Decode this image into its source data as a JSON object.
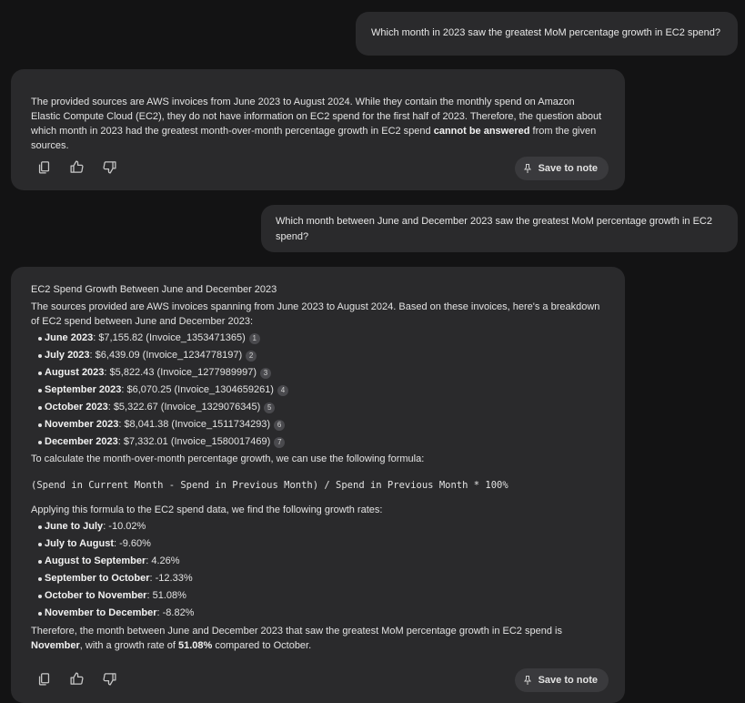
{
  "conversation": {
    "q1": "Which month in 2023 saw the greatest MoM percentage growth in EC2 spend?",
    "a1": {
      "pre": "The provided sources are AWS invoices from June 2023 to August 2024. While they contain the monthly spend on Amazon Elastic Compute Cloud (EC2), they do not have information on EC2 spend for the first half of 2023. Therefore, the question about which month in 2023 had the greatest month-over-month percentage growth in EC2 spend ",
      "bold": "cannot be answered",
      "post": " from the given sources."
    },
    "q2": "Which month between June and December 2023 saw the greatest MoM percentage growth in EC2 spend?",
    "a2": {
      "title": "EC2 Spend Growth Between June and December 2023",
      "intro": "The sources provided are AWS invoices spanning from June 2023 to August 2024. Based on these invoices, here's a breakdown of EC2 spend between June and December 2023:",
      "spend": [
        {
          "month": "June 2023",
          "rest": ": $7,155.82 (Invoice_1353471365)",
          "cite": "1"
        },
        {
          "month": "July 2023",
          "rest": ": $6,439.09 (Invoice_1234778197)",
          "cite": "2"
        },
        {
          "month": "August 2023",
          "rest": ": $5,822.43 (Invoice_1277989997)",
          "cite": "3"
        },
        {
          "month": "September 2023",
          "rest": ": $6,070.25 (Invoice_1304659261)",
          "cite": "4"
        },
        {
          "month": "October 2023",
          "rest": ": $5,322.67 (Invoice_1329076345)",
          "cite": "5"
        },
        {
          "month": "November 2023",
          "rest": ": $8,041.38 (Invoice_1511734293)",
          "cite": "6"
        },
        {
          "month": "December 2023",
          "rest": ": $7,332.01 (Invoice_1580017469)",
          "cite": "7"
        }
      ],
      "calc_intro": "To calculate the month-over-month percentage growth, we can use the following formula:",
      "formula": "(Spend in Current Month - Spend in Previous Month) / Spend in Previous Month * 100%",
      "apply": "Applying this formula to the EC2 spend data, we find the following growth rates:",
      "growth": [
        {
          "label": "June to July",
          "value": ": -10.02%"
        },
        {
          "label": "July to August",
          "value": ": -9.60%"
        },
        {
          "label": "August to September",
          "value": ": 4.26%"
        },
        {
          "label": "September to October",
          "value": ": -12.33%"
        },
        {
          "label": "October to November",
          "value": ": 51.08%"
        },
        {
          "label": "November to December",
          "value": ": -8.82%"
        }
      ],
      "concl_pre": "Therefore, the month between June and December 2023 that saw the greatest MoM percentage growth in EC2 spend is ",
      "concl_month": "November",
      "concl_mid": ", with a growth rate of ",
      "concl_rate": "51.08%",
      "concl_post": " compared to October."
    }
  },
  "actions": {
    "save_label": "Save to note",
    "icons": [
      "copy-icon",
      "thumbs-up-icon",
      "thumbs-down-icon",
      "pin-icon"
    ]
  }
}
